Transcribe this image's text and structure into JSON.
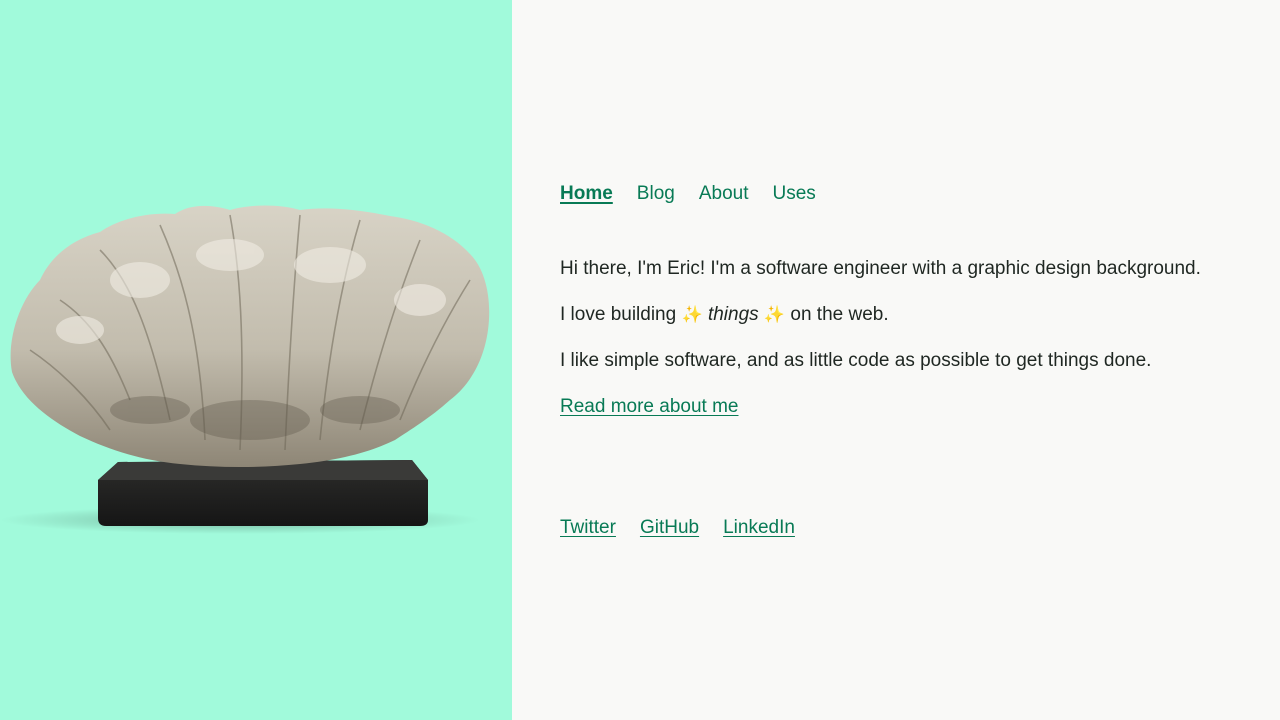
{
  "hero": {
    "image_subject": "coral-specimen-on-stand",
    "background_color": "#a1fadb"
  },
  "nav": {
    "items": [
      {
        "label": "Home",
        "active": true
      },
      {
        "label": "Blog",
        "active": false
      },
      {
        "label": "About",
        "active": false
      },
      {
        "label": "Uses",
        "active": false
      }
    ]
  },
  "intro": {
    "line1": "Hi there, I'm Eric! I'm a software engineer with a graphic design background.",
    "line2_prefix": "I love building",
    "line2_sparkle": "✨",
    "line2_emphasis": "things",
    "line2_suffix": "on the web.",
    "line3": "I like simple software, and as little code as possible to get things done.",
    "read_more": "Read more about me"
  },
  "social": {
    "items": [
      {
        "label": "Twitter"
      },
      {
        "label": "GitHub"
      },
      {
        "label": "LinkedIn"
      }
    ]
  },
  "colors": {
    "accent": "#087a55",
    "text": "#1f2722",
    "background": "#f9f9f7"
  }
}
